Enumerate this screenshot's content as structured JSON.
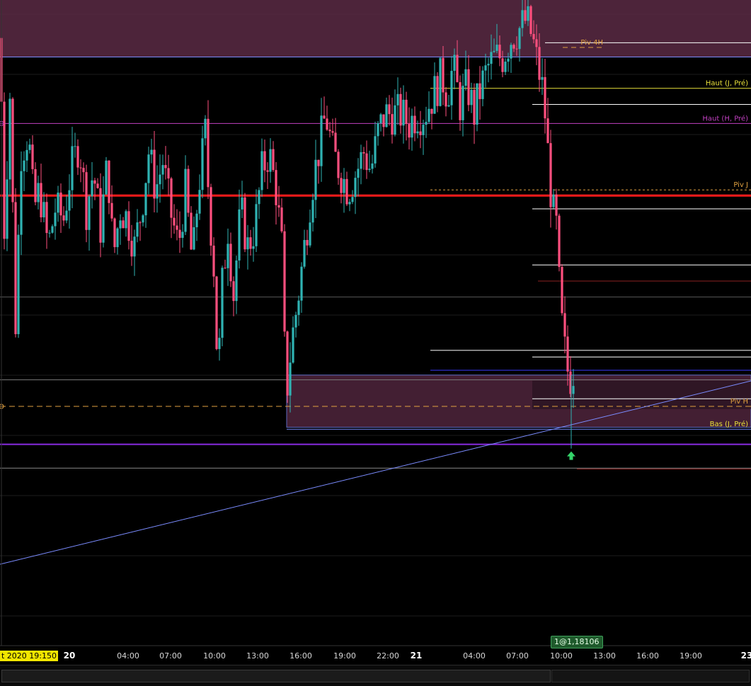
{
  "chart_data": {
    "type": "candlestick",
    "instrument": "",
    "ylim": [
      1.1784,
      1.1852
    ],
    "colors": {
      "up": "#2fb3b3",
      "down": "#ff4f7e",
      "pivot_main": "#ff1a1a",
      "zone_fill": "#5a2a44",
      "zone_border": "#7a8cff",
      "trendline": "#7b8cff",
      "level_white": "#ffffff",
      "level_yellow": "#e8e03a",
      "level_magenta": "#c040c0",
      "level_orange": "#e0a040",
      "level_purple": "#8a2be2",
      "grid": "#1c1c1c",
      "arrow": "#34d46a"
    },
    "key_prices": {
      "zone_top_high": 1.1849,
      "zone_top_low": 1.1846,
      "haut_h_pre": 1.1839,
      "piv_j": 1.1832,
      "pivot_main": 1.18314,
      "zone_bot_high": 1.18125,
      "zone_bot_low": 1.1807,
      "piv_h": 1.18092,
      "bas_j_pre": 1.18068,
      "purple_line": 1.18052,
      "order_price": 1.18106
    },
    "candle_path": [
      [
        0,
        1.1848
      ],
      [
        6,
        1.1828
      ],
      [
        14,
        1.1842
      ],
      [
        22,
        1.1818
      ],
      [
        30,
        1.1836
      ],
      [
        40,
        1.1838
      ],
      [
        48,
        1.183
      ],
      [
        56,
        1.1832
      ],
      [
        68,
        1.1826
      ],
      [
        78,
        1.183
      ],
      [
        90,
        1.1829
      ],
      [
        100,
        1.1834
      ],
      [
        112,
        1.1837
      ],
      [
        122,
        1.183
      ],
      [
        132,
        1.1834
      ],
      [
        142,
        1.1828
      ],
      [
        152,
        1.1835
      ],
      [
        160,
        1.1825
      ],
      [
        170,
        1.183
      ],
      [
        180,
        1.1829
      ],
      [
        190,
        1.1826
      ],
      [
        200,
        1.183
      ],
      [
        210,
        1.1836
      ],
      [
        220,
        1.1832
      ],
      [
        230,
        1.1835
      ],
      [
        240,
        1.183
      ],
      [
        252,
        1.1826
      ],
      [
        262,
        1.1832
      ],
      [
        272,
        1.1824
      ],
      [
        280,
        1.1832
      ],
      [
        290,
        1.1838
      ],
      [
        296,
        1.183
      ],
      [
        302,
        1.1824
      ],
      [
        308,
        1.1812
      ],
      [
        314,
        1.1822
      ],
      [
        322,
        1.1828
      ],
      [
        330,
        1.1821
      ],
      [
        340,
        1.183
      ],
      [
        350,
        1.1826
      ],
      [
        360,
        1.1828
      ],
      [
        370,
        1.1834
      ],
      [
        380,
        1.1836
      ],
      [
        390,
        1.1832
      ],
      [
        398,
        1.1826
      ],
      [
        404,
        1.181
      ],
      [
        412,
        1.1816
      ],
      [
        420,
        1.182
      ],
      [
        430,
        1.1826
      ],
      [
        440,
        1.1832
      ],
      [
        450,
        1.1836
      ],
      [
        460,
        1.184
      ],
      [
        470,
        1.1836
      ],
      [
        480,
        1.1834
      ],
      [
        492,
        1.1832
      ],
      [
        504,
        1.1834
      ],
      [
        514,
        1.1836
      ],
      [
        524,
        1.1834
      ],
      [
        534,
        1.1838
      ],
      [
        544,
        1.184
      ],
      [
        556,
        1.184
      ],
      [
        566,
        1.184
      ],
      [
        578,
        1.1839
      ],
      [
        588,
        1.184
      ],
      [
        600,
        1.184
      ],
      [
        612,
        1.1842
      ],
      [
        624,
        1.1844
      ],
      [
        632,
        1.1842
      ],
      [
        640,
        1.1845
      ],
      [
        650,
        1.1841
      ],
      [
        660,
        1.1843
      ],
      [
        670,
        1.184
      ],
      [
        680,
        1.1843
      ],
      [
        690,
        1.1845
      ],
      [
        700,
        1.1846
      ],
      [
        710,
        1.1846
      ],
      [
        722,
        1.1848
      ],
      [
        734,
        1.1849
      ],
      [
        744,
        1.185
      ],
      [
        752,
        1.1848
      ],
      [
        760,
        1.1845
      ],
      [
        768,
        1.1842
      ],
      [
        774,
        1.1836
      ],
      [
        780,
        1.183
      ],
      [
        786,
        1.1828
      ],
      [
        792,
        1.1819
      ],
      [
        798,
        1.1815
      ],
      [
        804,
        1.1812
      ],
      [
        810,
        1.1813
      ]
    ],
    "x_axis": {
      "labels": [
        {
          "text": "20",
          "bold": true
        },
        {
          "text": "04:00"
        },
        {
          "text": "07:00"
        },
        {
          "text": "10:00"
        },
        {
          "text": "13:00"
        },
        {
          "text": "16:00"
        },
        {
          "text": "19:00"
        },
        {
          "text": "22:00"
        },
        {
          "text": "21",
          "bold": true
        },
        {
          "text": "04:00"
        },
        {
          "text": "07:00"
        },
        {
          "text": "10:00"
        },
        {
          "text": "13:00"
        },
        {
          "text": "16:00"
        },
        {
          "text": "19:00"
        },
        {
          "text": "23",
          "bold": true
        }
      ]
    },
    "level_labels": {
      "piv_4h": "Piv 4H",
      "haut_j_pre": "Haut (J, Pré)",
      "haut_h_pre": "Haut (H, Pré)",
      "piv_j": "Piv J",
      "piv_h": "Piv H",
      "bas_j_pre": "Bas (J, Pré)"
    }
  },
  "header": {
    "date_tag": "t 2020 19:15",
    "date_tag_suffix": "0"
  },
  "order_tag": "1@1,18106"
}
